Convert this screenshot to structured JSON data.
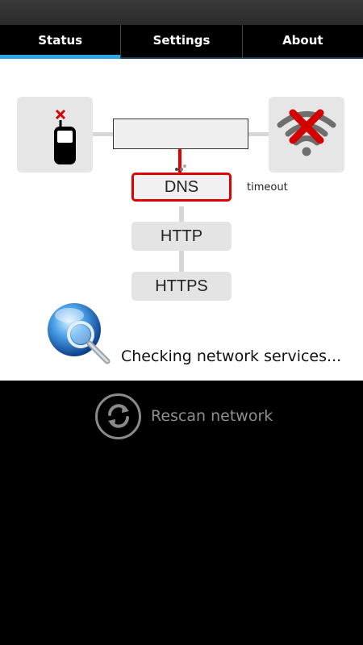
{
  "tabs": [
    {
      "label": "Status",
      "active": true
    },
    {
      "label": "Settings",
      "active": false
    },
    {
      "label": "About",
      "active": false
    }
  ],
  "diagram": {
    "phone_icon": "phone-icon",
    "phone_status_icon": "red-x-small-icon",
    "wifi_icon": "wifi-disconnected-icon",
    "services": [
      {
        "label": "DNS",
        "status": "timeout",
        "highlight": "#e00000"
      },
      {
        "label": "HTTP"
      },
      {
        "label": "HTTPS"
      }
    ]
  },
  "status_text": "Checking network services...",
  "rescan": {
    "label": "Rescan network",
    "icon": "refresh-icon"
  },
  "colors": {
    "accent": "#2ea6df",
    "error": "#e00000"
  }
}
